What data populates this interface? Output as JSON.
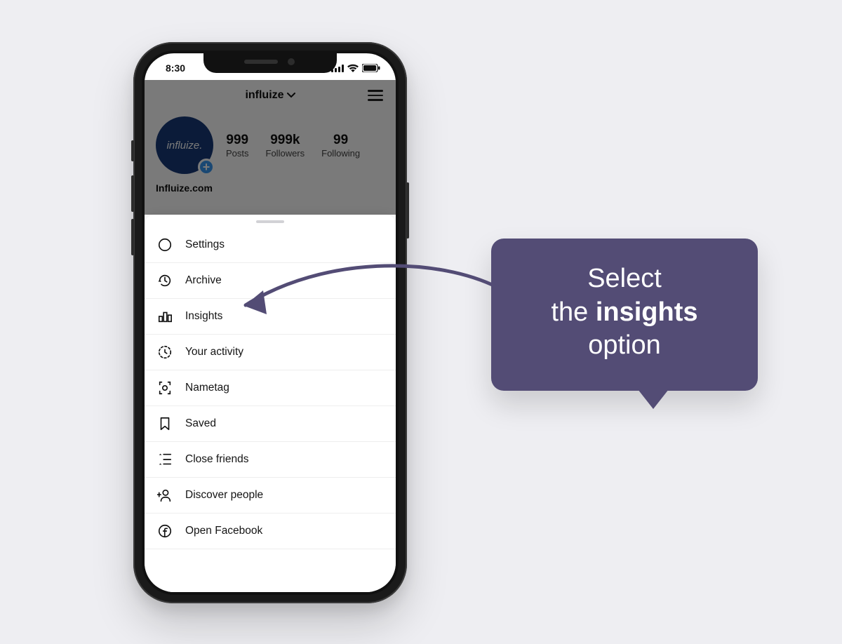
{
  "statusbar": {
    "time": "8:30"
  },
  "header": {
    "username": "influize"
  },
  "profile": {
    "avatar_text": "influize.",
    "bio": "Influize.com",
    "stats": {
      "posts": {
        "n": "999",
        "label": "Posts"
      },
      "followers": {
        "n": "999k",
        "label": "Followers"
      },
      "following": {
        "n": "99",
        "label": "Following"
      }
    }
  },
  "menu": {
    "items": [
      {
        "label": "Settings"
      },
      {
        "label": "Archive"
      },
      {
        "label": "Insights"
      },
      {
        "label": "Your activity"
      },
      {
        "label": "Nametag"
      },
      {
        "label": "Saved"
      },
      {
        "label": "Close friends"
      },
      {
        "label": "Discover people"
      },
      {
        "label": "Open Facebook"
      }
    ]
  },
  "callout": {
    "line1": "Select",
    "line2_pre": "the ",
    "line2_bold": "insights",
    "line3": "option"
  },
  "colors": {
    "accent": "#534c75",
    "brand": "#173a78"
  }
}
